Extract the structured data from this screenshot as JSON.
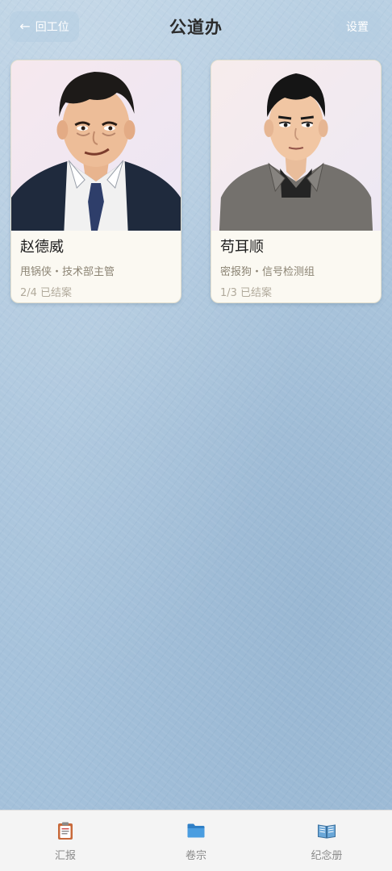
{
  "header": {
    "back_label": "回工位",
    "title": "公道办",
    "settings_label": "设置"
  },
  "cards": [
    {
      "name": "赵德威",
      "role": "甩锅侠・技术部主管",
      "progress": "2/4 已结案"
    },
    {
      "name": "苟耳顺",
      "role": "密报狗・信号检测组",
      "progress": "1/3 已结案"
    }
  ],
  "tabs": [
    {
      "label": "汇报",
      "icon": "clipboard-icon"
    },
    {
      "label": "卷宗",
      "icon": "folder-icon"
    },
    {
      "label": "纪念册",
      "icon": "book-icon"
    }
  ],
  "colors": {
    "background": "#a9c4dc",
    "card": "#fbf9f2",
    "tab_bar": "#f4f4f4",
    "folder_blue": "#3a8fd6",
    "clipboard_orange": "#c8693a"
  }
}
